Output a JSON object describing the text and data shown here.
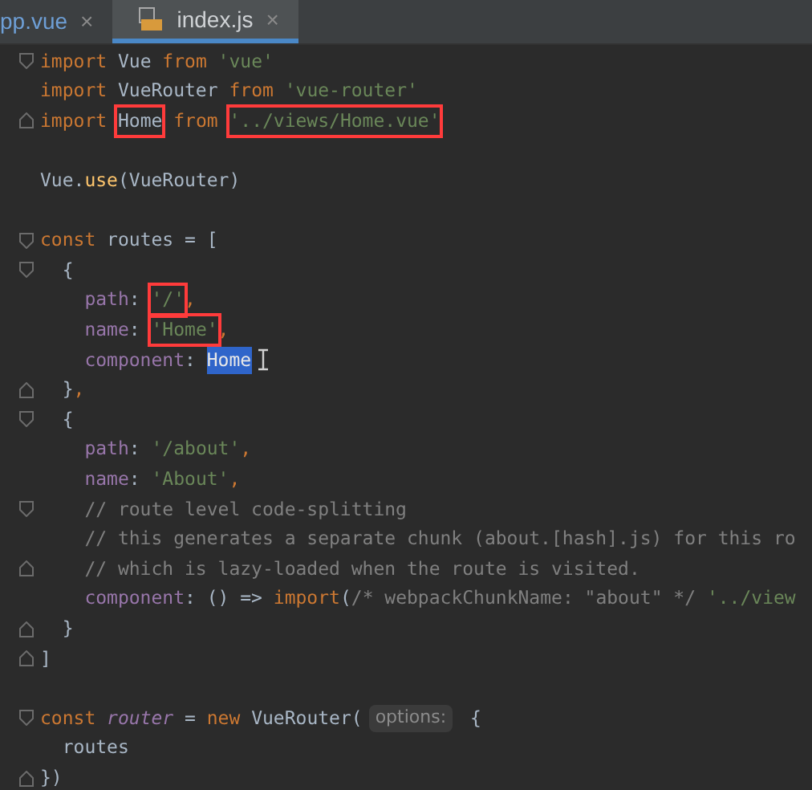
{
  "tabs": [
    {
      "label": "pp.vue",
      "close": "×",
      "selected": false,
      "kind": "plain"
    },
    {
      "label": "index.js",
      "close": "×",
      "selected": true,
      "kind": "js"
    }
  ],
  "lines": [
    {
      "kind": "opener",
      "tokens": [
        {
          "kind": "kw",
          "text": "import "
        },
        {
          "kind": "id",
          "text": "Vue "
        },
        {
          "kind": "kw",
          "text": "from "
        },
        {
          "kind": "str",
          "text": "'vue'"
        }
      ]
    },
    {
      "kind": "plain",
      "tokens": [
        {
          "kind": "kw",
          "text": "import "
        },
        {
          "kind": "id",
          "text": "VueRouter "
        },
        {
          "kind": "kw",
          "text": "from "
        },
        {
          "kind": "str",
          "text": "'vue-router'"
        }
      ]
    },
    {
      "kind": "closer",
      "tokens": [
        {
          "kind": "kw",
          "text": "import "
        },
        {
          "kind": "id",
          "text": "Home",
          "boxed": true
        },
        {
          "kind": "kw",
          "text": " from "
        },
        {
          "kind": "str",
          "text": "'../views/Home.vue'",
          "boxed": true
        }
      ]
    },
    {
      "kind": "plain"
    },
    {
      "kind": "plain",
      "tokens": [
        {
          "kind": "id",
          "text": "Vue."
        },
        {
          "kind": "fn",
          "text": "use"
        },
        {
          "kind": "id",
          "text": "(VueRouter)"
        }
      ]
    },
    {
      "kind": "plain"
    },
    {
      "kind": "opener",
      "tokens": [
        {
          "kind": "kw",
          "text": "const "
        },
        {
          "kind": "id",
          "text": "routes = ["
        }
      ]
    },
    {
      "kind": "opener",
      "tokens": [
        {
          "kind": "id",
          "text": "  {"
        }
      ]
    },
    {
      "kind": "plain",
      "tokens": [
        {
          "kind": "prop",
          "text": "    path"
        },
        {
          "kind": "id",
          "text": ": "
        },
        {
          "kind": "str",
          "text": "'/'",
          "boxed": true
        },
        {
          "kind": "kw",
          "text": ","
        }
      ]
    },
    {
      "kind": "plain",
      "tokens": [
        {
          "kind": "prop",
          "text": "    name"
        },
        {
          "kind": "id",
          "text": ": "
        },
        {
          "kind": "str",
          "text": "'Home'",
          "boxed": true
        },
        {
          "kind": "kw",
          "text": ","
        }
      ]
    },
    {
      "kind": "plain",
      "caret": true,
      "tokens": [
        {
          "kind": "prop",
          "text": "    component"
        },
        {
          "kind": "id",
          "text": ": "
        },
        {
          "kind": "id",
          "text": "Home",
          "selected": true
        }
      ]
    },
    {
      "kind": "closer",
      "tokens": [
        {
          "kind": "id",
          "text": "  }"
        },
        {
          "kind": "kw",
          "text": ","
        }
      ]
    },
    {
      "kind": "opener",
      "tokens": [
        {
          "kind": "id",
          "text": "  {"
        }
      ]
    },
    {
      "kind": "plain",
      "tokens": [
        {
          "kind": "prop",
          "text": "    path"
        },
        {
          "kind": "id",
          "text": ": "
        },
        {
          "kind": "str",
          "text": "'/about'"
        },
        {
          "kind": "kw",
          "text": ","
        }
      ]
    },
    {
      "kind": "plain",
      "tokens": [
        {
          "kind": "prop",
          "text": "    name"
        },
        {
          "kind": "id",
          "text": ": "
        },
        {
          "kind": "str",
          "text": "'About'"
        },
        {
          "kind": "kw",
          "text": ","
        }
      ]
    },
    {
      "kind": "opener",
      "tokens": [
        {
          "kind": "cmt",
          "text": "    // route level code-splitting"
        }
      ]
    },
    {
      "kind": "plain",
      "tokens": [
        {
          "kind": "cmt",
          "text": "    // this generates a separate chunk (about.[hash].js) for this ro"
        }
      ]
    },
    {
      "kind": "closer",
      "tokens": [
        {
          "kind": "cmt",
          "text": "    // which is lazy-loaded when the route is visited."
        }
      ]
    },
    {
      "kind": "plain",
      "tokens": [
        {
          "kind": "prop",
          "text": "    component"
        },
        {
          "kind": "id",
          "text": ": () => "
        },
        {
          "kind": "kw",
          "text": "import"
        },
        {
          "kind": "id",
          "text": "("
        },
        {
          "kind": "cmt",
          "text": "/* webpackChunkName: \"about\" */ "
        },
        {
          "kind": "str",
          "text": "'../view"
        }
      ]
    },
    {
      "kind": "closer",
      "tokens": [
        {
          "kind": "id",
          "text": "  }"
        }
      ]
    },
    {
      "kind": "closer",
      "tokens": [
        {
          "kind": "id",
          "text": "]"
        }
      ]
    },
    {
      "kind": "plain"
    },
    {
      "kind": "opener",
      "tokens": [
        {
          "kind": "kw",
          "text": "const "
        },
        {
          "kind": "var",
          "text": "router"
        },
        {
          "kind": "id",
          "text": " = "
        },
        {
          "kind": "kw",
          "text": "new "
        },
        {
          "kind": "id",
          "text": "VueRouter("
        },
        {
          "kind": "hint",
          "text": "options:"
        },
        {
          "kind": "id",
          "text": " {"
        }
      ]
    },
    {
      "kind": "plain",
      "tokens": [
        {
          "kind": "id",
          "text": "  routes"
        }
      ]
    },
    {
      "kind": "closer",
      "tokens": [
        {
          "kind": "id",
          "text": "})"
        }
      ]
    }
  ]
}
